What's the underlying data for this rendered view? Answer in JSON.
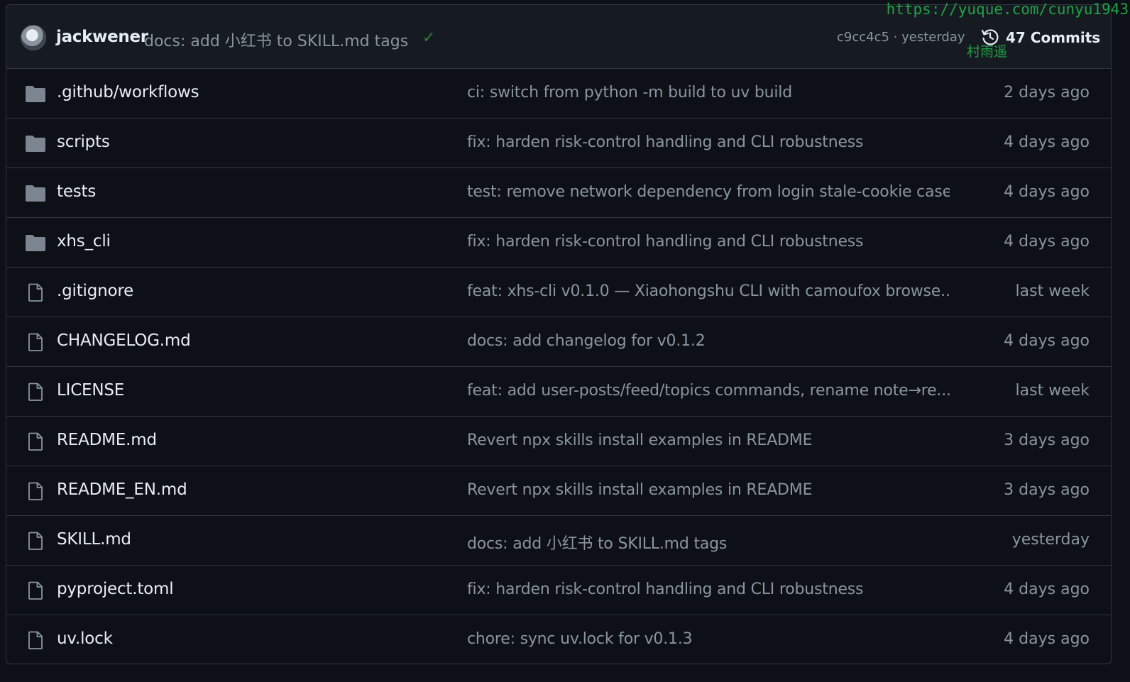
{
  "header": {
    "author": "jackwener",
    "message": "docs: add 小红书 to SKILL.md tags",
    "status": "success",
    "hash_time": "c9cc4c5 · yesterday",
    "commits_label": "47 Commits",
    "icons": {
      "avatar": "avatar",
      "status": "check-icon",
      "history": "history-icon"
    }
  },
  "watermark": {
    "url": "https://yuque.com/cunyu1943",
    "name": "村雨遥"
  },
  "colors": {
    "background": "#0d1117",
    "header_bg": "#161b22",
    "border": "#30363d",
    "text_primary": "#e6edf3",
    "text_muted": "#8b949e",
    "folder": "#7d8590",
    "watermark": "#22a045",
    "check": "#2f7d3a"
  },
  "files": [
    {
      "type": "folder",
      "icon": "folder-icon",
      "name": ".github/workflows",
      "message": "ci: switch from python -m build to uv build",
      "time": "2 days ago"
    },
    {
      "type": "folder",
      "icon": "folder-icon",
      "name": "scripts",
      "message": "fix: harden risk-control handling and CLI robustness",
      "time": "4 days ago"
    },
    {
      "type": "folder",
      "icon": "folder-icon",
      "name": "tests",
      "message": "test: remove network dependency from login stale-cookie case",
      "time": "4 days ago"
    },
    {
      "type": "folder",
      "icon": "folder-icon",
      "name": "xhs_cli",
      "message": "fix: harden risk-control handling and CLI robustness",
      "time": "4 days ago"
    },
    {
      "type": "file",
      "icon": "file-icon",
      "name": ".gitignore",
      "message": "feat: xhs-cli v0.1.0 — Xiaohongshu CLI with camoufox browse...",
      "time": "last week"
    },
    {
      "type": "file",
      "icon": "file-icon",
      "name": "CHANGELOG.md",
      "message": "docs: add changelog for v0.1.2",
      "time": "4 days ago"
    },
    {
      "type": "file",
      "icon": "file-icon",
      "name": "LICENSE",
      "message": "feat: add user-posts/feed/topics commands, rename note→re...",
      "time": "last week"
    },
    {
      "type": "file",
      "icon": "file-icon",
      "name": "README.md",
      "message": "Revert npx skills install examples in README",
      "time": "3 days ago"
    },
    {
      "type": "file",
      "icon": "file-icon",
      "name": "README_EN.md",
      "message": "Revert npx skills install examples in README",
      "time": "3 days ago"
    },
    {
      "type": "file",
      "icon": "file-icon",
      "name": "SKILL.md",
      "message": "docs: add 小红书 to SKILL.md tags",
      "time": "yesterday"
    },
    {
      "type": "file",
      "icon": "file-icon",
      "name": "pyproject.toml",
      "message": "fix: harden risk-control handling and CLI robustness",
      "time": "4 days ago"
    },
    {
      "type": "file",
      "icon": "file-icon",
      "name": "uv.lock",
      "message": "chore: sync uv.lock for v0.1.3",
      "time": "4 days ago"
    }
  ]
}
